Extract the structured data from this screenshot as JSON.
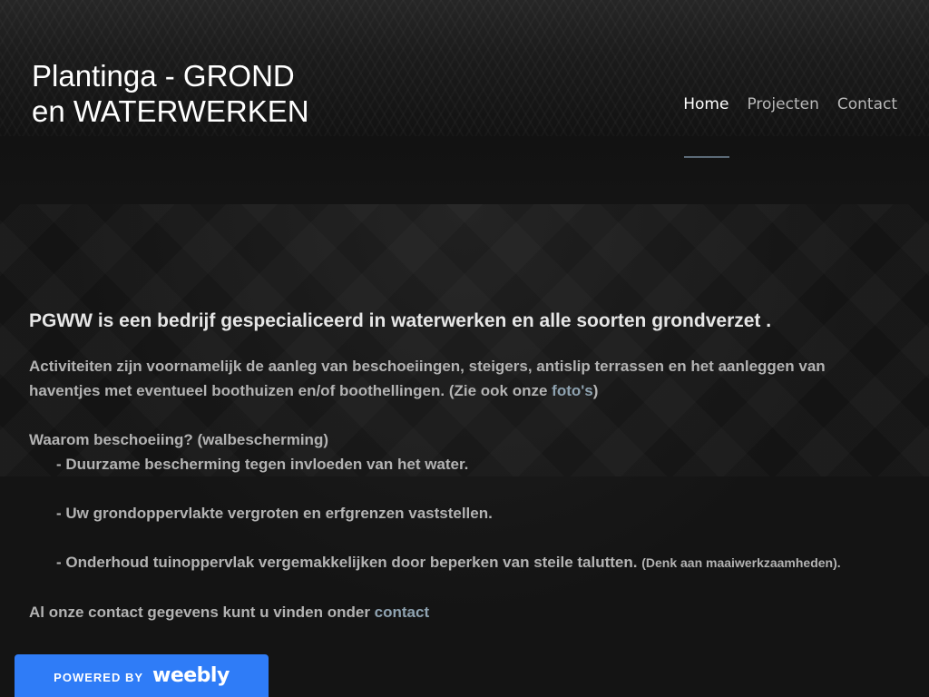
{
  "site": {
    "title": "Plantinga - GROND en WATERWERKEN"
  },
  "nav": {
    "items": [
      {
        "label": "Home",
        "active": true
      },
      {
        "label": "Projecten",
        "active": false
      },
      {
        "label": "Contact",
        "active": false
      }
    ]
  },
  "content": {
    "headline": "PGWW is een bedrijf  gespecialiceerd  in waterwerken en alle soorten grondverzet .",
    "activities_text": "Activiteiten zijn voornamelijk de aanleg van beschoeiingen, steigers, antislip terrassen en het aanleggen van haventjes met eventueel boothuizen en/of boothellingen. (Zie ook onze ",
    "activities_link": "foto's",
    "activities_close": ")",
    "why_heading": "Waarom beschoeiing? (walbescherming)",
    "bullet_1": "- Duurzame bescherming tegen invloeden van het  water.",
    "bullet_2": "- Uw grondoppervlakte vergroten en erfgrenzen  vaststellen.",
    "bullet_3": "- Onderhoud tuinoppervlak vergemakkelijken door  beperken van steile talutten.",
    "bullet_3_note": "(Denk aan maaiwerkzaamheden).",
    "contact_text": "Al onze contact gegevens kunt u vinden onder ",
    "contact_link": "contact"
  },
  "footer_banner": {
    "powered_by": "POWERED BY",
    "brand": "weebly"
  },
  "colors": {
    "background": "#141414",
    "link": "#8fa3b1",
    "banner": "#2f7cf7",
    "nav_underline": "#5b6a77"
  }
}
